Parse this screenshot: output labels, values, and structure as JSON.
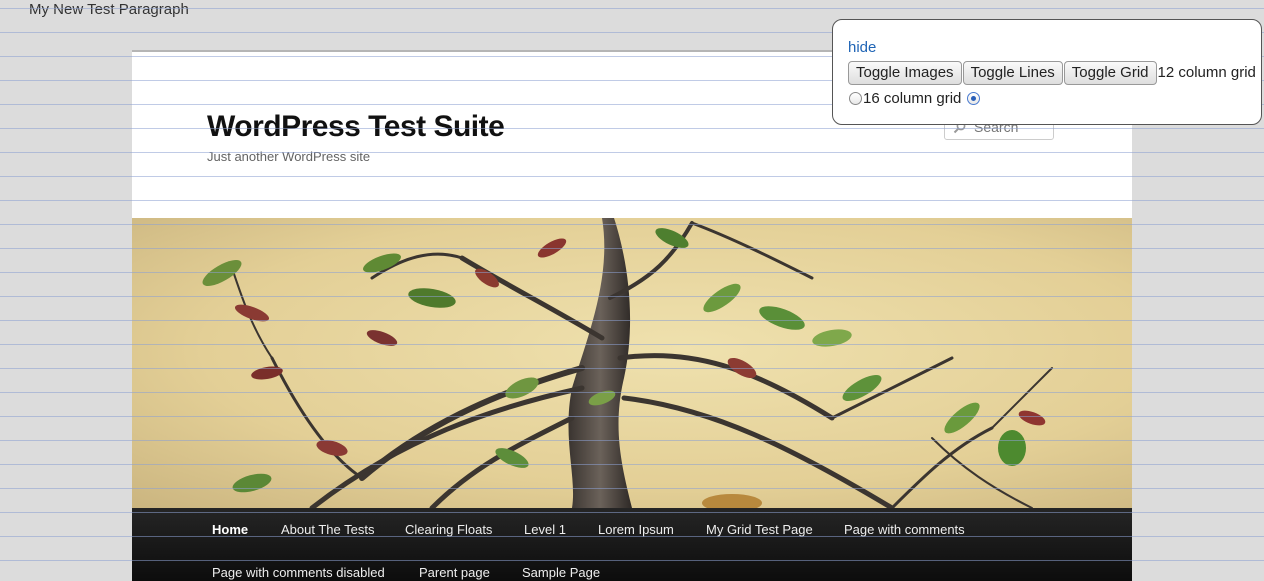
{
  "top_paragraph": "My New Test Paragraph",
  "site": {
    "title": "WordPress Test Suite",
    "description": "Just another WordPress site",
    "search_placeholder": "Search"
  },
  "nav": {
    "items": [
      {
        "label": "Home",
        "active": true
      },
      {
        "label": "About The Tests"
      },
      {
        "label": "Clearing Floats"
      },
      {
        "label": "Level 1"
      },
      {
        "label": "Lorem Ipsum"
      },
      {
        "label": "My Grid Test Page"
      },
      {
        "label": "Page with comments"
      },
      {
        "label": "Page with comments disabled"
      },
      {
        "label": "Parent page"
      },
      {
        "label": "Sample Page"
      }
    ]
  },
  "panel": {
    "hide_link": "hide",
    "buttons": [
      "Toggle Images",
      "Toggle Lines",
      "Toggle Grid"
    ],
    "option_12": "12 column grid",
    "option_16": "16 column grid",
    "selected": "16 column grid"
  },
  "colors": {
    "link": "#1f64b5",
    "nav_background": "#111111",
    "grid_line": "#8ca0d2"
  }
}
